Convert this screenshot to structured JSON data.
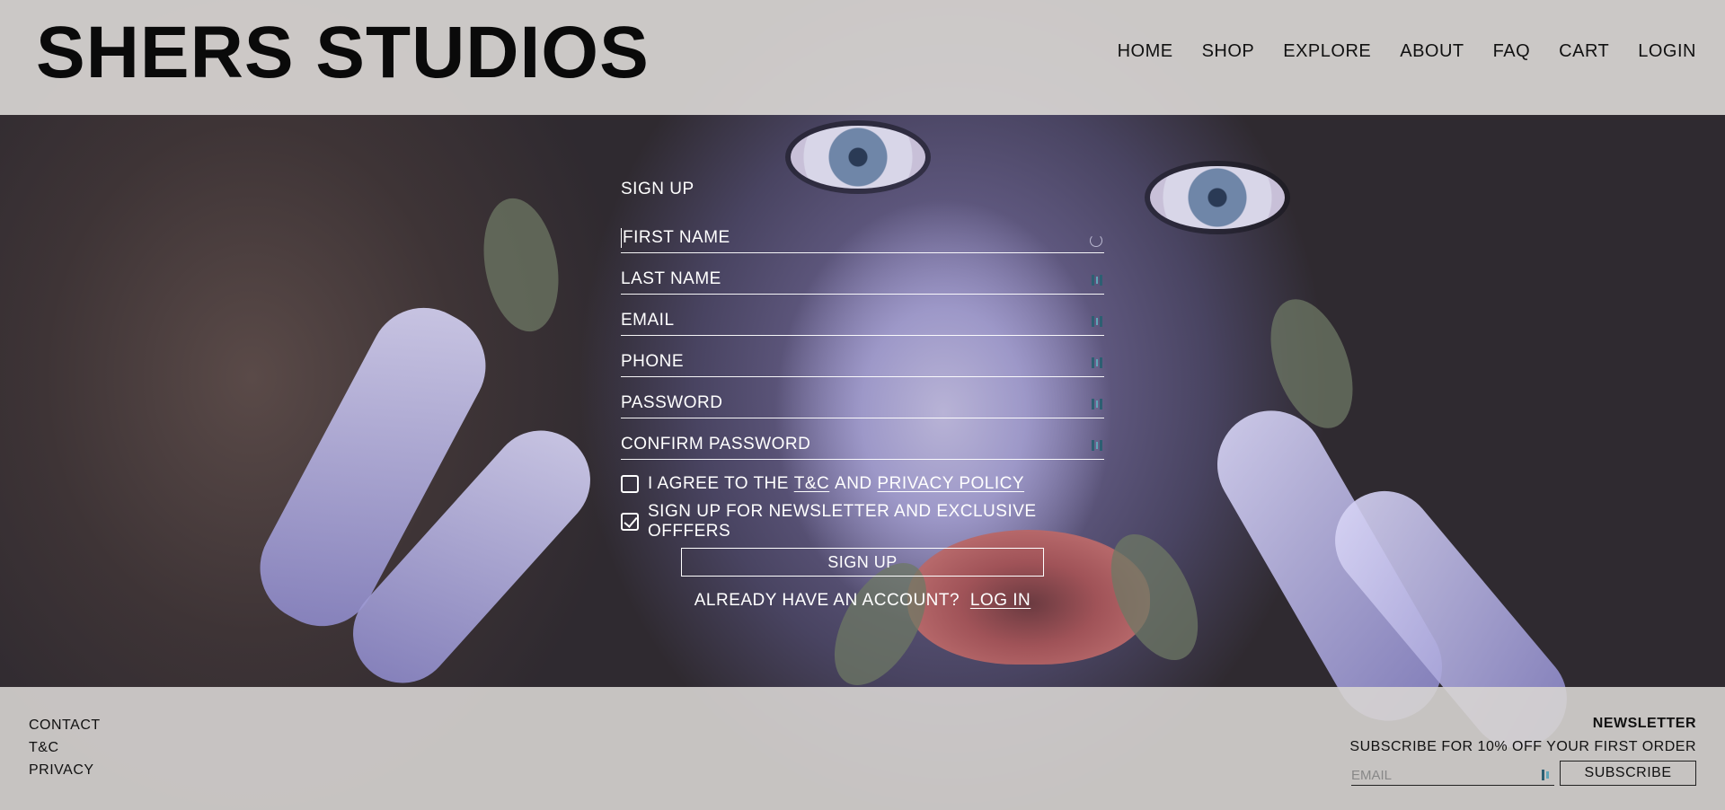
{
  "brand": {
    "name": "SHERS STUDIOS"
  },
  "nav": {
    "items": [
      {
        "label": "HOME"
      },
      {
        "label": "SHOP"
      },
      {
        "label": "EXPLORE"
      },
      {
        "label": "ABOUT"
      },
      {
        "label": "FAQ"
      },
      {
        "label": "CART"
      },
      {
        "label": "LOGIN"
      }
    ]
  },
  "signup": {
    "title": "SIGN UP",
    "fields": {
      "first_name": {
        "placeholder": "FIRST NAME",
        "value": ""
      },
      "last_name": {
        "placeholder": "LAST NAME",
        "value": ""
      },
      "email": {
        "placeholder": "EMAIL",
        "value": ""
      },
      "phone": {
        "placeholder": "PHONE",
        "value": ""
      },
      "password": {
        "placeholder": "PASSWORD",
        "value": ""
      },
      "confirm_password": {
        "placeholder": "CONFIRM PASSWORD",
        "value": ""
      }
    },
    "agree": {
      "prefix": "I AGREE TO THE",
      "terms_link": "T&C",
      "middle": "AND",
      "privacy_link": "PRIVACY POLICY",
      "checked": false
    },
    "newsletter_opt": {
      "label": "SIGN UP FOR NEWSLETTER AND EXCLUSIVE OFFFERS",
      "checked": true
    },
    "submit_label": "SIGN UP",
    "already": {
      "text": "ALREADY HAVE AN ACCOUNT?",
      "login_link": "LOG IN"
    }
  },
  "footer": {
    "links": [
      {
        "label": "CONTACT"
      },
      {
        "label": "T&C"
      },
      {
        "label": "PRIVACY"
      }
    ],
    "newsletter": {
      "title": "NEWSLETTER",
      "subtitle": "SUBSCRIBE FOR 10% OFF YOUR FIRST ORDER",
      "email_placeholder": "EMAIL",
      "subscribe_label": "SUBSCRIBE"
    }
  },
  "icons": {
    "password_manager": "password-manager-key-icon",
    "loading": "loading-spinner-icon",
    "checkbox_checked": "checkmark-icon"
  }
}
